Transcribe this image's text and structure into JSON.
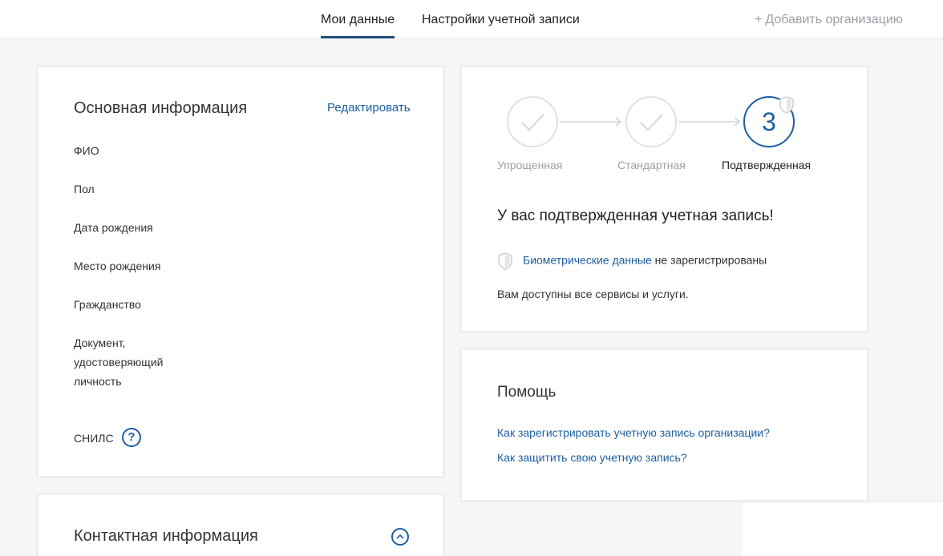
{
  "nav": {
    "tabs": [
      {
        "label": "Мои данные",
        "active": true
      },
      {
        "label": "Настройки учетной записи",
        "active": false
      }
    ],
    "add_org": {
      "plus": "+",
      "label": "Добавить организацию"
    }
  },
  "basic_info": {
    "title": "Основная информация",
    "edit_label": "Редактировать",
    "fields": {
      "fio": "ФИО",
      "gender": "Пол",
      "birth_date": "Дата рождения",
      "birth_place": "Место рождения",
      "citizenship": "Гражданство",
      "document_line1": "Документ,",
      "document_line2": "удостоверяющий",
      "document_line3": "личность",
      "snils": "СНИЛС"
    },
    "snils_help": "?"
  },
  "account_status": {
    "steps": [
      {
        "label": "Упрощенная",
        "state": "done"
      },
      {
        "label": "Стандартная",
        "state": "done"
      },
      {
        "label": "Подтвержденная",
        "state": "current",
        "number": "3"
      }
    ],
    "title": "У вас подтвержденная учетная запись!",
    "biometric_link": "Биометрические данные",
    "biometric_status": " не зарегистрированы",
    "access_text": "Вам доступны все сервисы и услуги."
  },
  "help": {
    "title": "Помощь",
    "links": [
      "Как зарегистрировать учетную запись организации?",
      "Как защитить свою учетную запись?"
    ]
  },
  "contact_info": {
    "title": "Контактная информация"
  },
  "colors": {
    "accent": "#1d5ea0",
    "muted": "#9aa0a6",
    "border": "#eceff1",
    "background": "#f5f6f7"
  }
}
